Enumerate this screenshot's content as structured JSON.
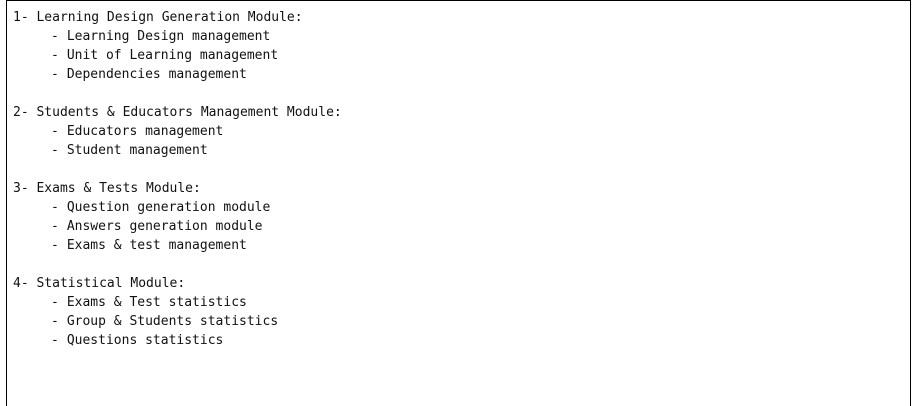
{
  "modules": [
    {
      "title": "1- Learning Design Generation Module:",
      "items": [
        "Learning Design management",
        "Unit of Learning management",
        "Dependencies management"
      ]
    },
    {
      "title": "2- Students & Educators Management Module:",
      "items": [
        "Educators management",
        "Student management"
      ]
    },
    {
      "title": "3- Exams & Tests Module:",
      "items": [
        "Question generation module",
        "Answers generation module",
        "Exams & test management"
      ]
    },
    {
      "title": "4- Statistical Module:",
      "items": [
        "Exams & Test statistics",
        "Group & Students statistics",
        "Questions statistics"
      ]
    }
  ],
  "bullet": "-"
}
